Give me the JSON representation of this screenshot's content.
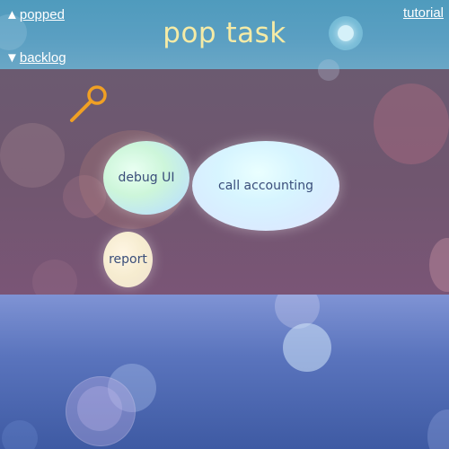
{
  "header": {
    "popped_label": "popped",
    "backlog_label": "backlog",
    "tutorial_label": "tutorial",
    "title": "pop task",
    "popped_arrow": "▲",
    "backlog_arrow": "▼"
  },
  "tasks": [
    {
      "label": "debug UI"
    },
    {
      "label": "call accounting"
    },
    {
      "label": "report"
    }
  ],
  "icons": {
    "search": "search-icon"
  },
  "colors": {
    "header_bg": "#5a9fc2",
    "title_text": "#f5eba6",
    "task_area_bg": "#70566f",
    "backlog_bg": "#5a74bd",
    "search_icon": "#f0a024",
    "bubble_text": "#3a4e7a"
  }
}
